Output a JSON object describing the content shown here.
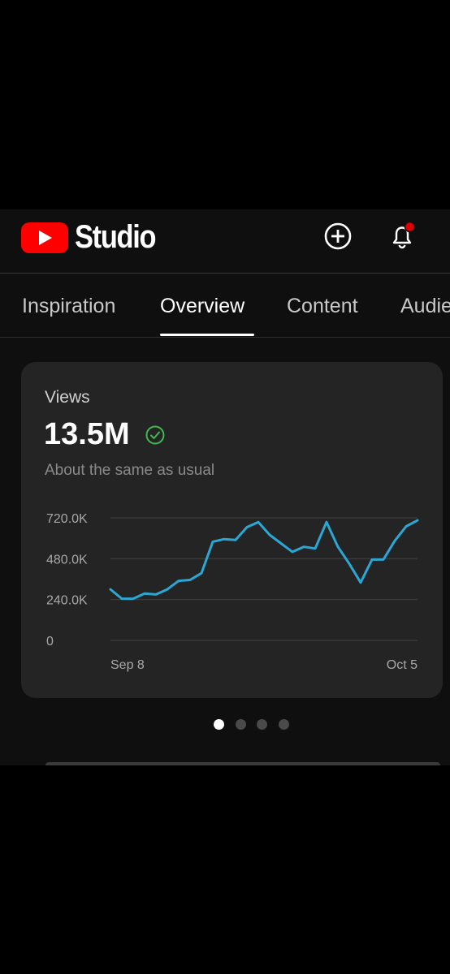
{
  "header": {
    "app_name": "Studio",
    "logo_icon": "youtube-play-icon",
    "create_icon": "add-circle-icon",
    "notification_icon": "bell-icon",
    "notification_dot_color": "#e00000",
    "brand_color": "#ff0000"
  },
  "tabs": [
    {
      "label": "Inspiration",
      "active": false
    },
    {
      "label": "Overview",
      "active": true
    },
    {
      "label": "Content",
      "active": false
    },
    {
      "label": "Audie",
      "active": false
    }
  ],
  "card": {
    "label": "Views",
    "value": "13.5M",
    "status_icon": "check-circle-icon",
    "status_color": "#3fb950",
    "subtitle": "About the same as usual"
  },
  "chart_data": {
    "type": "line",
    "line_color": "#2aa7d4",
    "y_ticks": [
      "720.0K",
      "480.0K",
      "240.0K",
      "0"
    ],
    "y_tick_values": [
      720000,
      480000,
      240000,
      0
    ],
    "ylim": [
      0,
      720000
    ],
    "x_labels": [
      "Sep 8",
      "Oct 5"
    ],
    "x": [
      "Sep 8",
      "Sep 9",
      "Sep 10",
      "Sep 11",
      "Sep 12",
      "Sep 13",
      "Sep 14",
      "Sep 15",
      "Sep 16",
      "Sep 17",
      "Sep 18",
      "Sep 19",
      "Sep 20",
      "Sep 21",
      "Sep 22",
      "Sep 23",
      "Sep 24",
      "Sep 25",
      "Sep 26",
      "Sep 27",
      "Sep 28",
      "Sep 29",
      "Sep 30",
      "Oct 1",
      "Oct 2",
      "Oct 3",
      "Oct 4",
      "Oct 5"
    ],
    "series": [
      {
        "values": [
          300000,
          245000,
          245000,
          275000,
          270000,
          300000,
          350000,
          355000,
          395000,
          580000,
          595000,
          590000,
          665000,
          695000,
          620000,
          570000,
          520000,
          550000,
          540000,
          695000,
          550000,
          450000,
          340000,
          475000,
          475000,
          585000,
          670000,
          705000
        ]
      }
    ],
    "grid": true
  },
  "pagination": {
    "count": 4,
    "active_index": 0
  }
}
